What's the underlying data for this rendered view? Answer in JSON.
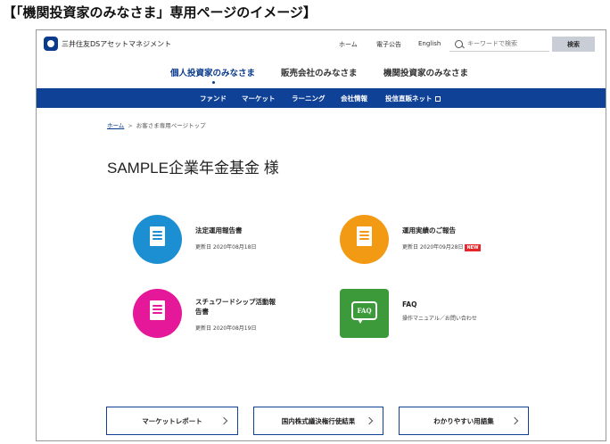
{
  "caption": "【「機関投資家のみなさま」専用ページのイメージ】",
  "header": {
    "logo_text": "三井住友DSアセットマネジメント",
    "links": [
      "ホーム",
      "電子公告",
      "English"
    ],
    "search_placeholder": "キーワードで検索",
    "search_button": "検索"
  },
  "audience_tabs": [
    {
      "label": "個人投資家のみなさま",
      "active": true
    },
    {
      "label": "販売会社のみなさま",
      "active": false
    },
    {
      "label": "機関投資家のみなさま",
      "active": false
    }
  ],
  "main_nav": [
    "ファンド",
    "マーケット",
    "ラーニング",
    "会社情報",
    "投信直販ネット"
  ],
  "breadcrumb": {
    "home": "ホーム",
    "separator": ">",
    "current": "お客さま専用ページトップ"
  },
  "page_title": "SAMPLE企業年金基金 様",
  "documents": [
    {
      "title": "法定運用報告書",
      "meta": "更新日 2020年08月18日",
      "badge": "",
      "color": "#1b8fd1"
    },
    {
      "title": "運用実績のご報告",
      "meta": "更新日 2020年09月28日",
      "badge": "NEW",
      "color": "#f39a14"
    },
    {
      "title_line1": "スチュワードシップ活動報",
      "title_line2": "告書",
      "meta": "更新日 2020年08月19日",
      "badge": "",
      "color": "#e5189a"
    },
    {
      "title": "FAQ",
      "meta": "操作マニュアル／お問い合わせ",
      "badge": "",
      "icon_text": "FAQ",
      "color": "#3d9a3a"
    }
  ],
  "bottom_buttons": [
    "マーケットレポート",
    "国内株式議決権行使結果",
    "わかりやすい用語集"
  ]
}
